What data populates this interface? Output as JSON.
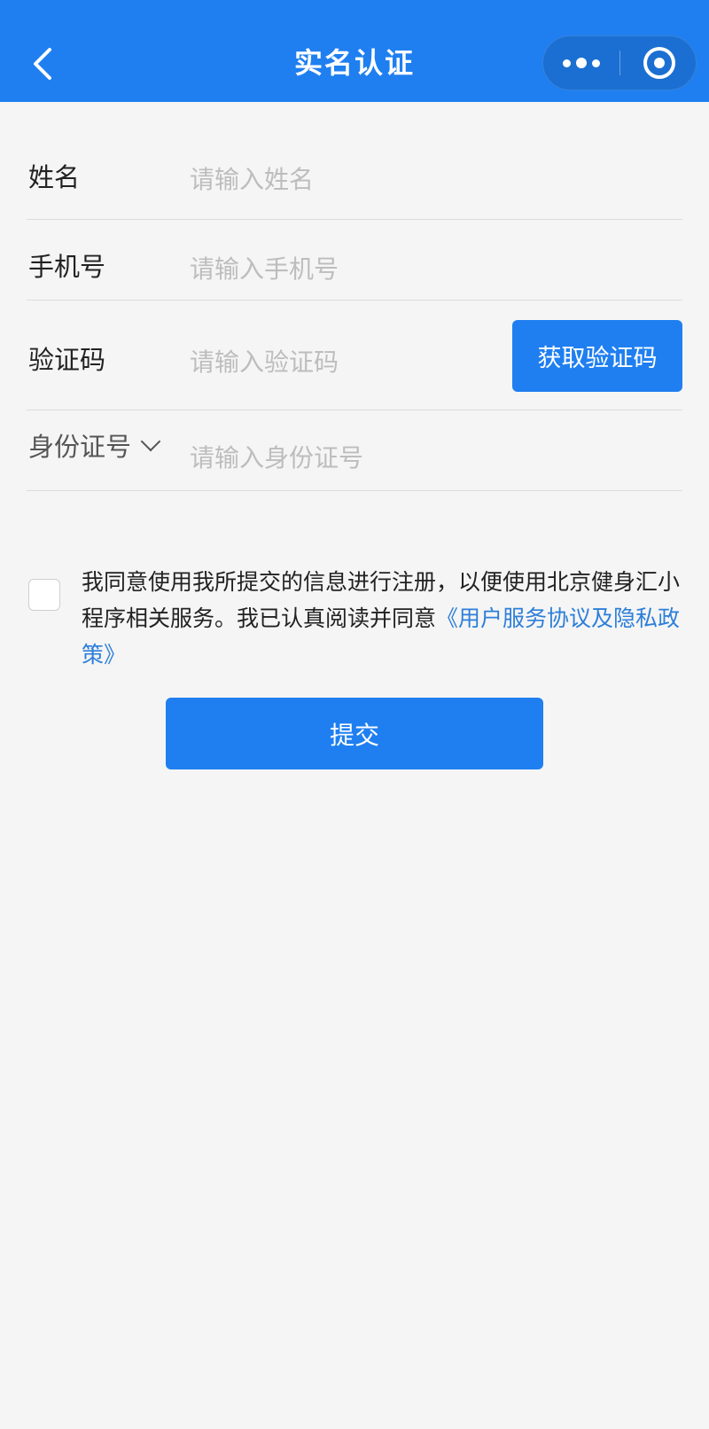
{
  "nav": {
    "back_icon": "chevron-left-icon",
    "title": "实名认证",
    "more_icon": "more-dots-icon",
    "close_icon": "target-circle-icon",
    "color": "#1f7ff0"
  },
  "form": {
    "name": {
      "label": "姓名",
      "placeholder": "请输入姓名"
    },
    "phone": {
      "label": "手机号",
      "placeholder": "请输入手机号"
    },
    "code": {
      "label": "验证码",
      "placeholder": "请输入验证码",
      "button": "获取验证码"
    },
    "id": {
      "label": "身份证号",
      "placeholder": "请输入身份证号",
      "dropdown_icon": "chevron-down-icon"
    }
  },
  "agreement": {
    "checked": false,
    "text": "我同意使用我所提交的信息进行注册，以便使用北京健身汇小程序相关服务。我已认真阅读并同意",
    "link": "《用户服务协议及隐私政策》",
    "link_color": "#2d7fd9"
  },
  "submit_label": "提交"
}
